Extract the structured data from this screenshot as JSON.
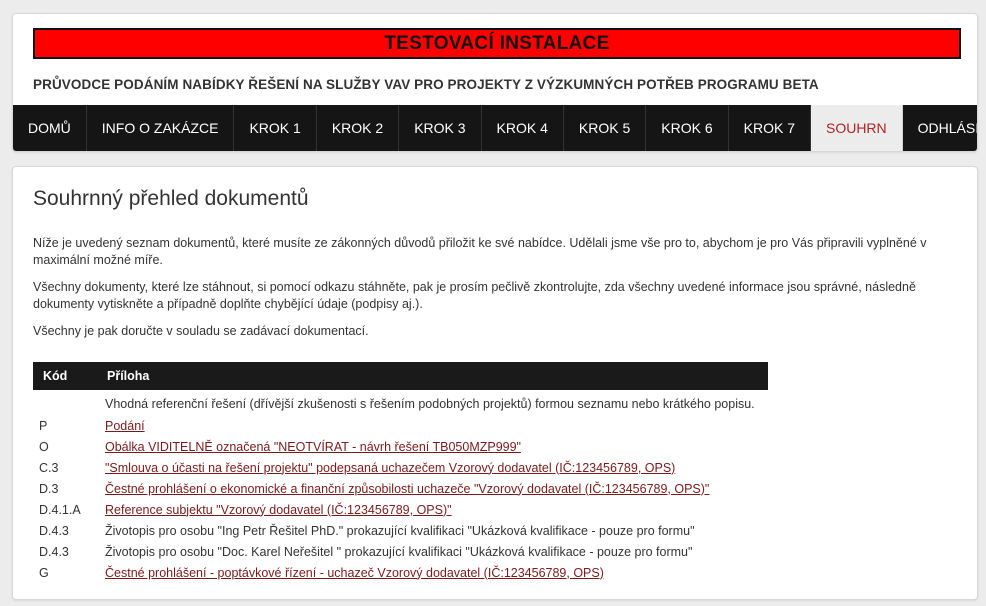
{
  "header": {
    "banner": "TESTOVACÍ INSTALACE",
    "wizard_title": "PRŮVODCE PODÁNÍM NABÍDKY ŘEŠENÍ NA SLUŽBY VAV PRO PROJEKTY Z VÝZKUMNÝCH POTŘEB PROGRAMU BETA"
  },
  "nav": {
    "items": [
      {
        "label": "DOMŮ"
      },
      {
        "label": "INFO O ZAKÁZCE"
      },
      {
        "label": "KROK 1"
      },
      {
        "label": "KROK 2"
      },
      {
        "label": "KROK 3"
      },
      {
        "label": "KROK 4"
      },
      {
        "label": "KROK 5"
      },
      {
        "label": "KROK 6"
      },
      {
        "label": "KROK 7"
      },
      {
        "label": "SOUHRN"
      },
      {
        "label": "ODHLÁSIT"
      }
    ],
    "active_index": 9
  },
  "main": {
    "title": "Souhrnný přehled dokumentů",
    "paragraphs": [
      "Níže je uvedený seznam dokumentů, které musíte ze zákonných důvodů přiložit ke své nabídce. Udělali jsme vše pro to, abychom je pro Vás připravili vyplněné v maximální možné míře.",
      "Všechny dokumenty, které lze stáhnout, si pomocí odkazu stáhněte, pak je prosím pečlivě zkontrolujte, zda všechny uvedené informace jsou správné, následně dokumenty vytiskněte a případně doplňte chybějící údaje (podpisy aj.).",
      "Všechny je pak doručte v souladu se zadávací dokumentací."
    ],
    "table": {
      "headers": {
        "code": "Kód",
        "attachment": "Příloha"
      },
      "rows": [
        {
          "code": "",
          "text": "Vhodná referenční řešení (dřívější zkušenosti s řešením podobných projektů) formou seznamu nebo krátkého popisu.",
          "link": false
        },
        {
          "code": "P",
          "text": "Podání",
          "link": true
        },
        {
          "code": "O",
          "text": "Obálka VIDITELNĚ označená \"NEOTVÍRAT - návrh řešení TB050MZP999\"",
          "link": true
        },
        {
          "code": "C.3",
          "text": "\"Smlouva o účasti na řešení projektu\" podepsaná uchazečem Vzorový dodavatel (IČ:123456789, OPS)",
          "link": true
        },
        {
          "code": "D.3",
          "text": "Čestné prohlášení o ekonomické a finanční způsobilosti uchazeče \"Vzorový dodavatel (IČ:123456789, OPS)\"",
          "link": true
        },
        {
          "code": "D.4.1.A",
          "text": "Reference subjektu \"Vzorový dodavatel (IČ:123456789, OPS)\"",
          "link": true
        },
        {
          "code": "D.4.3",
          "text": "Životopis pro osobu \"Ing Petr Řešitel PhD.\" prokazující kvalifikaci \"Ukázková kvalifikace - pouze pro formu\"",
          "link": false
        },
        {
          "code": "D.4.3",
          "text": "Životopis pro osobu \"Doc. Karel Neřešitel \" prokazující kvalifikaci \"Ukázková kvalifikace - pouze pro formu\"",
          "link": false
        },
        {
          "code": "G",
          "text": "Čestné prohlášení - poptávkové řízení - uchazeč Vzorový dodavatel (IČ:123456789, OPS)",
          "link": true
        }
      ]
    }
  },
  "colors": {
    "banner_bg": "#ff0000",
    "nav_bg": "#151515",
    "active_tab_text": "#b22222",
    "link": "#7a1a1a"
  }
}
